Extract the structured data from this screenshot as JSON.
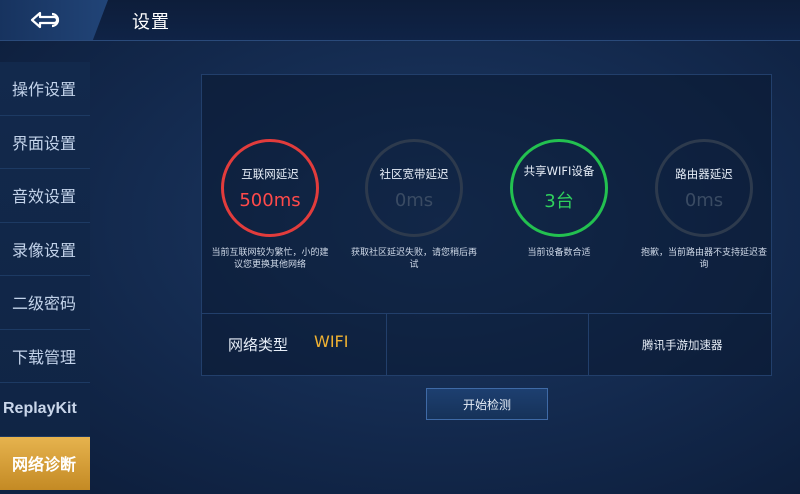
{
  "header": {
    "title": "设置",
    "back_icon": "back-arrow-icon"
  },
  "sidebar": {
    "items": [
      {
        "label": "操作设置"
      },
      {
        "label": "界面设置"
      },
      {
        "label": "音效设置"
      },
      {
        "label": "录像设置"
      },
      {
        "label": "二级密码"
      },
      {
        "label": "下载管理"
      },
      {
        "label": "ReplayKit"
      },
      {
        "label": "网络诊断"
      }
    ],
    "active_index": 7
  },
  "metrics": [
    {
      "title": "互联网延迟",
      "value": "500ms",
      "status": "red",
      "desc": "当前互联网较为繁忙，小的建议您更换其他网络"
    },
    {
      "title": "社区宽带延迟",
      "value": "0ms",
      "status": "inactive",
      "desc": "获取社区延迟失败，请您稍后再试"
    },
    {
      "title": "共享WIFI设备",
      "value": "3台",
      "status": "green",
      "desc": "当前设备数合适"
    },
    {
      "title": "路由器延迟",
      "value": "0ms",
      "status": "inactive",
      "desc": "抱歉，当前路由器不支持延迟查询"
    }
  ],
  "network": {
    "type_label": "网络类型",
    "type_value": "WIFI",
    "accelerator_label": "腾讯手游加速器"
  },
  "actions": {
    "start_label": "开始检测"
  },
  "colors": {
    "accent_gold": "#f0b232",
    "alert_red": "#e23c3c",
    "ok_green": "#23c150"
  }
}
